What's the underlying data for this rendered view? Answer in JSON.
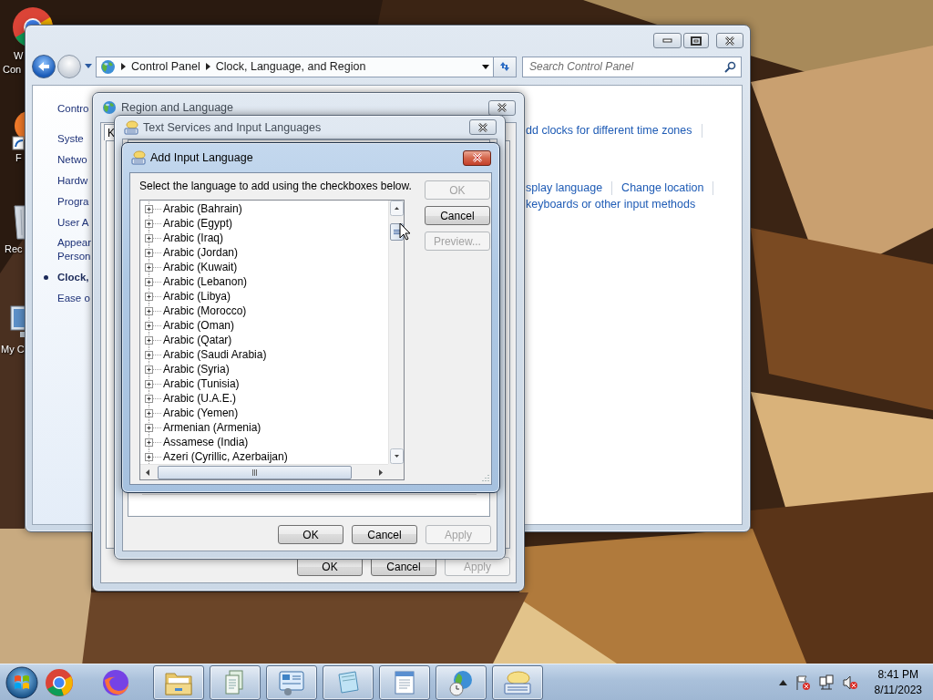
{
  "desktop_icons": [
    {
      "kind": "browser",
      "lines": [
        "W",
        "Con"
      ]
    },
    {
      "kind": "shortcut",
      "lines": [
        "F"
      ]
    },
    {
      "kind": "bin",
      "lines": [
        "Rec"
      ]
    },
    {
      "kind": "computer",
      "lines": [
        "My C"
      ]
    }
  ],
  "control_panel": {
    "breadcrumbs": [
      "Control Panel",
      "Clock, Language, and Region"
    ],
    "search": {
      "placeholder": "Search Control Panel"
    },
    "sidebar": [
      {
        "kind": "home",
        "lines": [
          "Contro"
        ],
        "selected": false
      },
      {
        "kind": "link",
        "lines": [
          "Syste"
        ],
        "selected": false
      },
      {
        "kind": "link",
        "lines": [
          "Netwo"
        ],
        "selected": false
      },
      {
        "kind": "link",
        "lines": [
          "Hardw"
        ],
        "selected": false
      },
      {
        "kind": "link",
        "lines": [
          "Progra"
        ],
        "selected": false
      },
      {
        "kind": "link",
        "lines": [
          "User A"
        ],
        "selected": false
      },
      {
        "kind": "link",
        "lines": [
          "Appear",
          "Person"
        ],
        "selected": false
      },
      {
        "kind": "link",
        "lines": [
          "Clock,"
        ],
        "selected": true
      },
      {
        "kind": "link",
        "lines": [
          "Ease o"
        ],
        "selected": false
      }
    ],
    "link_rows": [
      {
        "kind": "first",
        "links": [
          "dd clocks for different time zones"
        ],
        "separator": true
      },
      {
        "kind": "first",
        "links": [
          "splay language",
          "Change location"
        ],
        "separator": true
      },
      {
        "kind": "next",
        "links": [
          "keyboards or other input methods"
        ],
        "separator": false
      }
    ]
  },
  "region_dialog": {
    "title": "Region and Language",
    "tab_label": "K",
    "buttons": [
      {
        "label": "OK",
        "disabled": false
      },
      {
        "label": "Cancel",
        "disabled": false
      },
      {
        "label": "Apply",
        "disabled": true
      }
    ]
  },
  "text_services_dialog": {
    "title": "Text Services and Input Languages",
    "buttons": [
      {
        "label": "OK",
        "disabled": false
      },
      {
        "label": "Cancel",
        "disabled": false
      },
      {
        "label": "Apply",
        "disabled": true
      }
    ]
  },
  "add_language_dialog": {
    "title": "Add Input Language",
    "instruction": "Select the language to add using the checkboxes below.",
    "languages": [
      {
        "label": "Arabic (Bahrain)",
        "expanded": false
      },
      {
        "label": "Arabic (Egypt)",
        "expanded": false
      },
      {
        "label": "Arabic (Iraq)",
        "expanded": false
      },
      {
        "label": "Arabic (Jordan)",
        "expanded": false
      },
      {
        "label": "Arabic (Kuwait)",
        "expanded": false
      },
      {
        "label": "Arabic (Lebanon)",
        "expanded": false
      },
      {
        "label": "Arabic (Libya)",
        "expanded": false
      },
      {
        "label": "Arabic (Morocco)",
        "expanded": false
      },
      {
        "label": "Arabic (Oman)",
        "expanded": false
      },
      {
        "label": "Arabic (Qatar)",
        "expanded": false
      },
      {
        "label": "Arabic (Saudi Arabia)",
        "expanded": false
      },
      {
        "label": "Arabic (Syria)",
        "expanded": false
      },
      {
        "label": "Arabic (Tunisia)",
        "expanded": false
      },
      {
        "label": "Arabic (U.A.E.)",
        "expanded": false
      },
      {
        "label": "Arabic (Yemen)",
        "expanded": false
      },
      {
        "label": "Armenian (Armenia)",
        "expanded": false
      },
      {
        "label": "Assamese (India)",
        "expanded": false
      },
      {
        "label": "Azeri (Cyrillic, Azerbaijan)",
        "expanded": false
      }
    ],
    "buttons": [
      {
        "label": "OK",
        "disabled": true
      },
      {
        "label": "Cancel",
        "disabled": false
      },
      {
        "label": "Preview...",
        "disabled": true
      }
    ]
  },
  "taskbar": {
    "items": [
      {
        "kind": "browser",
        "running": false
      },
      {
        "kind": "firefox",
        "running": false
      },
      {
        "kind": "folder",
        "running": true
      },
      {
        "kind": "document",
        "running": true
      },
      {
        "kind": "panel",
        "running": true
      },
      {
        "kind": "notepad",
        "running": true
      },
      {
        "kind": "wordpad",
        "running": true
      },
      {
        "kind": "globe",
        "running": true
      },
      {
        "kind": "keyboard",
        "running": true
      }
    ],
    "clock": {
      "time": "8:41 PM",
      "date": "8/11/2023"
    }
  }
}
